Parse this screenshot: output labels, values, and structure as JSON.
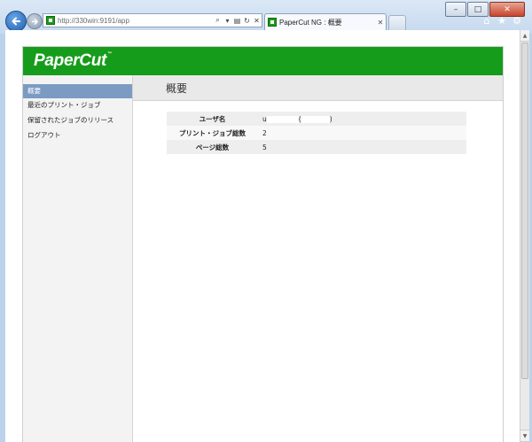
{
  "browser": {
    "url": "http://330win:9191/app",
    "tab_title": "PaperCut NG : 概要",
    "tab_close": "✕",
    "window_buttons": {
      "minimize": "–",
      "maximize": "□",
      "close": "✕"
    },
    "icons": [
      "back-arrow-icon",
      "forward-arrow-icon",
      "search-icon",
      "refresh-icon",
      "stop-icon",
      "home-icon",
      "favorites-star-icon",
      "gear-icon"
    ]
  },
  "app": {
    "logo": "PaperCut",
    "logo_tm": "™",
    "page_title": "概要",
    "sidebar": {
      "items": [
        {
          "label": "概要",
          "active": true
        },
        {
          "label": "最近のプリント・ジョブ",
          "active": false
        },
        {
          "label": "保留されたジョブのリリース",
          "active": false
        },
        {
          "label": "ログアウト",
          "active": false
        }
      ]
    },
    "summary": {
      "rows": [
        {
          "key": "ユーザ名",
          "value_prefix": "u",
          "value_open": "(",
          "value_close": ")"
        },
        {
          "key": "プリント・ジョブ総数",
          "value": "2"
        },
        {
          "key": "ページ総数",
          "value": "5"
        }
      ]
    }
  },
  "colors": {
    "header_green": "#169c1b",
    "sidebar_active": "#7b9bc3",
    "titlebar": "#e9e9e9"
  }
}
